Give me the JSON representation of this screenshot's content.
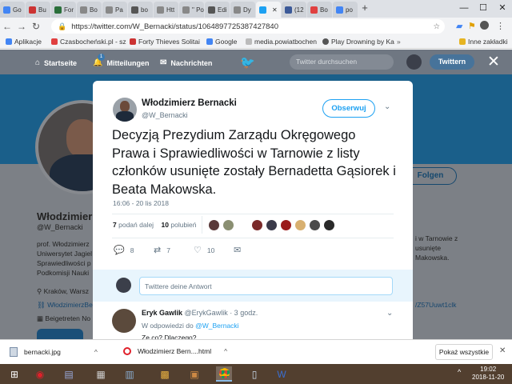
{
  "browser": {
    "tabs": [
      {
        "label": "Go",
        "color": "#4285f4"
      },
      {
        "label": "Bu",
        "color": "#cc3333"
      },
      {
        "label": "For",
        "color": "#2a6f3a"
      },
      {
        "label": "Bo",
        "color": "#888888"
      },
      {
        "label": "Pa",
        "color": "#888888"
      },
      {
        "label": "bo",
        "color": "#555555"
      },
      {
        "label": "Htt",
        "color": "#888888"
      },
      {
        "label": "\" Po",
        "color": "#888888"
      },
      {
        "label": "Edi",
        "color": "#555555"
      },
      {
        "label": "Dy",
        "color": "#888888"
      },
      {
        "label": "",
        "color": "#1da1f2"
      },
      {
        "label": "(12",
        "color": "#3b5998"
      },
      {
        "label": "Bo",
        "color": "#e04040"
      },
      {
        "label": "po",
        "color": "#4285f4"
      }
    ],
    "new_tab": "+",
    "window_controls": {
      "minimize": "—",
      "maximize": "☐",
      "close": "✕"
    },
    "url": "https://twitter.com/W_Bernacki/status/1064897725387427840",
    "nav": {
      "back": "←",
      "forward": "→",
      "reload": "↻"
    },
    "bookmarks": [
      {
        "label": "Aplikacje",
        "color": "#4285f4"
      },
      {
        "label": "Czasbocheński.pl - sz",
        "color": "#e04040"
      },
      {
        "label": "Forty Thieves Solitai",
        "color": "#cc3333"
      },
      {
        "label": "Google",
        "color": "#4285f4"
      },
      {
        "label": "media.powiatbochen",
        "color": "#888888"
      },
      {
        "label": "Play Drowning by Ka",
        "color": "#555555"
      },
      {
        "label": "Inne zakładki",
        "color": "#888888"
      }
    ],
    "more_bookmarks_icon": "»"
  },
  "twitter_nav": {
    "home": "Startseite",
    "mentions": "Mitteilungen",
    "mentions_badge": "1",
    "messages": "Nachrichten",
    "search_placeholder": "Twitter durchsuchen",
    "tweet_button": "Twittern",
    "close": "✕"
  },
  "background_profile": {
    "name": "Włodzimier",
    "handle": "@W_Bernacki",
    "bio_lines": [
      "prof. Włodzimierz",
      "Uniwersytet Jagiel",
      "Sprawiedliwości p",
      "Podkomisji Nauki"
    ],
    "right_lines": [
      "i w Tarnowie z",
      "usunięte",
      "Makowska."
    ],
    "location": "Kraków, Warsz",
    "link": "WłodzimierzBe",
    "joined": "Beigetreten No",
    "follow_button": "Folgen",
    "link_right": "/Z57Uuwt1clk"
  },
  "tweet": {
    "author_name": "Włodzimierz Bernacki",
    "author_handle": "@W_Bernacki",
    "follow_button": "Obserwuj",
    "text": "Decyzją Prezydium Zarządu Okręgowego Prawa i Sprawiedliwości w Tarnowie z listy członków usunięte zostały Bernadetta Gąsiorek i Beata Makowska.",
    "timestamp": "16:06 - 20 lis 2018",
    "retweets_count": "7",
    "retweets_label": "podań dalej",
    "likes_count": "10",
    "likes_label": "polubień",
    "actions": {
      "replies": "8",
      "retweets": "7",
      "likes": "10"
    },
    "reply_placeholder": "Twittere deine Antwort"
  },
  "reply": {
    "author_name": "Eryk Gawlik",
    "author_handle": "@ErykGawlik · 3 godz.",
    "in_reply_prefix": "W odpowiedzi do",
    "in_reply_handle": "@W_Bernacki",
    "text": "Ze co? Dlaczego?"
  },
  "downloads": {
    "item1": "bernacki.jpg",
    "item2": "Włodzimierz Bern....html",
    "show_all": "Pokaż wszystkie",
    "close": "✕"
  },
  "taskbar": {
    "time": "19:02",
    "date": "2018-11-20"
  },
  "colors": {
    "twitter_blue": "#1da1f2",
    "overlay_nav": "#6f7782",
    "taskbar": "#523f2f"
  }
}
